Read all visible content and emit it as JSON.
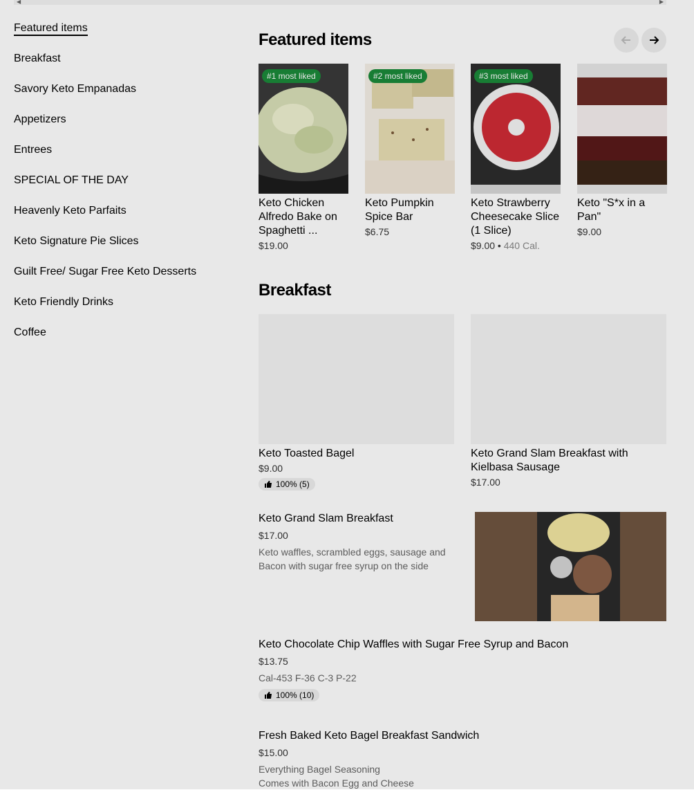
{
  "sidebar": {
    "items": [
      {
        "label": "Featured items",
        "active": true
      },
      {
        "label": "Breakfast"
      },
      {
        "label": "Savory Keto Empanadas"
      },
      {
        "label": "Appetizers"
      },
      {
        "label": "Entrees"
      },
      {
        "label": "SPECIAL OF THE DAY"
      },
      {
        "label": "Heavenly Keto Parfaits"
      },
      {
        "label": "Keto Signature Pie Slices"
      },
      {
        "label": "Guilt Free/ Sugar Free Keto Desserts"
      },
      {
        "label": "Keto Friendly Drinks"
      },
      {
        "label": "Coffee"
      }
    ]
  },
  "featured": {
    "title": "Featured items",
    "prev_icon": "arrow-left-icon",
    "next_icon": "arrow-right-icon",
    "items": [
      {
        "badge": "#1 most liked",
        "name": "Keto Chicken Alfredo Bake on Spaghetti ...",
        "price": "$19.00"
      },
      {
        "badge": "#2 most liked",
        "name": "Keto Pumpkin Spice Bar",
        "price": "$6.75"
      },
      {
        "badge": "#3 most liked",
        "name": "Keto Strawberry Cheesecake Slice (1 Slice)",
        "price": "$9.00",
        "calories": "440 Cal."
      },
      {
        "name": "Keto \"S*x in a Pan\"",
        "price": "$9.00"
      }
    ]
  },
  "breakfast": {
    "title": "Breakfast",
    "cards": [
      {
        "name": "Keto Toasted Bagel",
        "price": "$9.00",
        "rating": "100% (5)"
      },
      {
        "name": "Keto Grand Slam Breakfast with Kielbasa Sausage",
        "price": "$17.00"
      }
    ],
    "list": [
      {
        "name": "Keto Grand Slam Breakfast",
        "price": "$17.00",
        "description": "Keto waffles, scrambled eggs, sausage and Bacon with sugar free syrup on the side"
      },
      {
        "name": "Keto Chocolate Chip Waffles with Sugar Free Syrup and Bacon",
        "price": "$13.75",
        "description": "Cal-453 F-36 C-3 P-22",
        "rating": "100% (10)"
      },
      {
        "name": "Fresh Baked Keto Bagel Breakfast Sandwich",
        "price": "$15.00",
        "description_line1": "Everything Bagel Seasoning",
        "description_line2": "Comes with Bacon Egg and Cheese"
      }
    ]
  }
}
